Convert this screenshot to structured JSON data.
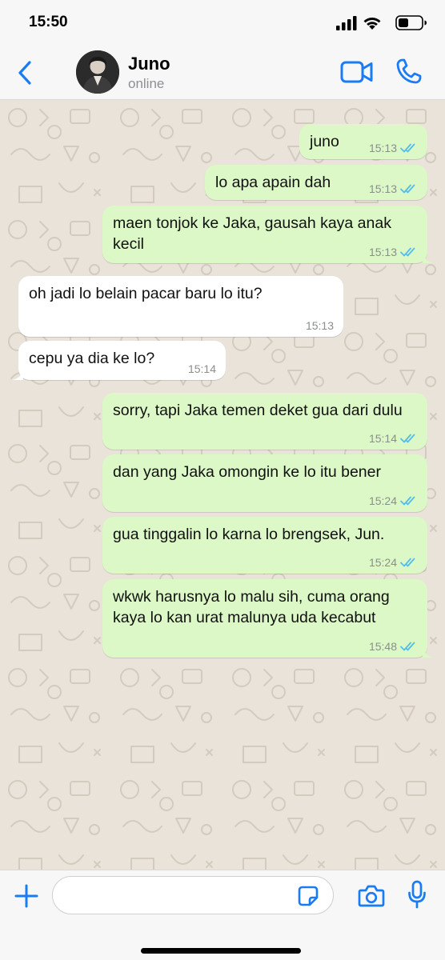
{
  "status_bar": {
    "time": "15:50",
    "icons": [
      "cellular-signal-icon",
      "wifi-icon",
      "battery-icon"
    ]
  },
  "header": {
    "contact_name": "Juno",
    "contact_status": "online",
    "icons": [
      "back-chevron-icon",
      "avatar",
      "video-call-icon",
      "phone-call-icon"
    ]
  },
  "messages": [
    {
      "direction": "outgoing",
      "text": "juno",
      "time": "15:13",
      "status": "read"
    },
    {
      "direction": "outgoing",
      "text": "lo apa apain dah",
      "time": "15:13",
      "status": "read"
    },
    {
      "direction": "outgoing",
      "text": "maen tonjok ke Jaka, gausah kaya anak kecil",
      "time": "15:13",
      "status": "read"
    },
    {
      "direction": "incoming",
      "text": "oh jadi lo belain pacar baru lo itu?",
      "time": "15:13"
    },
    {
      "direction": "incoming",
      "text": "cepu ya dia ke lo?",
      "time": "15:14"
    },
    {
      "direction": "outgoing",
      "text": "sorry, tapi Jaka temen deket gua dari dulu",
      "time": "15:14",
      "status": "read"
    },
    {
      "direction": "outgoing",
      "text": "dan yang Jaka omongin ke lo itu bener",
      "time": "15:24",
      "status": "read"
    },
    {
      "direction": "outgoing",
      "text": "gua tinggalin lo karna lo brengsek, Jun.",
      "time": "15:24",
      "status": "read"
    },
    {
      "direction": "outgoing",
      "text": "wkwk harusnya lo malu sih, cuma orang kaya lo kan urat malunya uda kecabut",
      "time": "15:48",
      "status": "read"
    }
  ],
  "input_bar": {
    "placeholder": "",
    "value": "",
    "icons": [
      "plus-icon",
      "sticker-icon",
      "camera-icon",
      "microphone-icon"
    ]
  },
  "colors": {
    "accent": "#1a7cf5",
    "outgoing_bubble": "#dcf8c6",
    "incoming_bubble": "#ffffff",
    "chat_background": "#e9e3d9",
    "read_ticks": "#53bdeb",
    "bar_background": "#f7f7f7"
  }
}
